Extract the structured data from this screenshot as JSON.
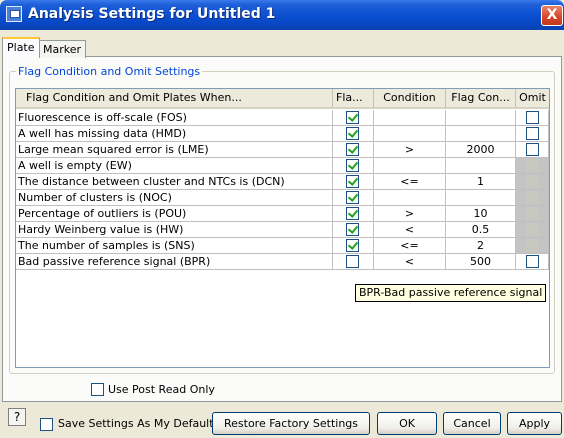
{
  "window": {
    "title": "Analysis Settings for Untitled 1",
    "close_glyph": "X"
  },
  "tabs": [
    {
      "label": "Plate"
    },
    {
      "label": "Marker"
    }
  ],
  "group": {
    "title": "Flag Condition and Omit Settings"
  },
  "table": {
    "headers": [
      "Flag Condition and Omit Plates When...",
      "Fla...",
      "Condition",
      "Flag Con...",
      "Omit"
    ],
    "rows": [
      {
        "name": "Fluorescence is off-scale  (FOS)",
        "flag": true,
        "condition": "",
        "value": "",
        "omit": false,
        "omit_enabled": true
      },
      {
        "name": "A well has missing data  (HMD)",
        "flag": true,
        "condition": "",
        "value": "",
        "omit": false,
        "omit_enabled": true
      },
      {
        "name": "Large mean squared error is  (LME)",
        "flag": true,
        "condition": ">",
        "value": "2000",
        "omit": false,
        "omit_enabled": true
      },
      {
        "name": "A well is empty  (EW)",
        "flag": true,
        "condition": "",
        "value": "",
        "omit": false,
        "omit_enabled": false
      },
      {
        "name": "The distance between cluster and NTCs is  (DCN)",
        "flag": true,
        "condition": "<=",
        "value": "1",
        "omit": false,
        "omit_enabled": false
      },
      {
        "name": "Number of clusters is  (NOC)",
        "flag": true,
        "condition": "",
        "value": "",
        "omit": false,
        "omit_enabled": false
      },
      {
        "name": "Percentage of outliers is  (POU)",
        "flag": true,
        "condition": ">",
        "value": "10",
        "omit": false,
        "omit_enabled": false
      },
      {
        "name": "Hardy Weinberg value is  (HW)",
        "flag": true,
        "condition": "<",
        "value": "0.5",
        "omit": false,
        "omit_enabled": false
      },
      {
        "name": "The number of samples is  (SNS)",
        "flag": true,
        "condition": "<=",
        "value": "2",
        "omit": false,
        "omit_enabled": false
      },
      {
        "name": "Bad passive reference signal  (BPR)",
        "flag": false,
        "condition": "<",
        "value": "500",
        "omit": false,
        "omit_enabled": true
      }
    ]
  },
  "tooltip": "BPR-Bad passive reference signal",
  "options": {
    "post_read_only_label": "Use Post Read Only",
    "save_default_label": "Save Settings As My Default"
  },
  "footer": {
    "help_label": "?",
    "restore_label": "Restore Factory Settings",
    "ok_label": "OK",
    "cancel_label": "Cancel",
    "apply_label": "Apply"
  }
}
